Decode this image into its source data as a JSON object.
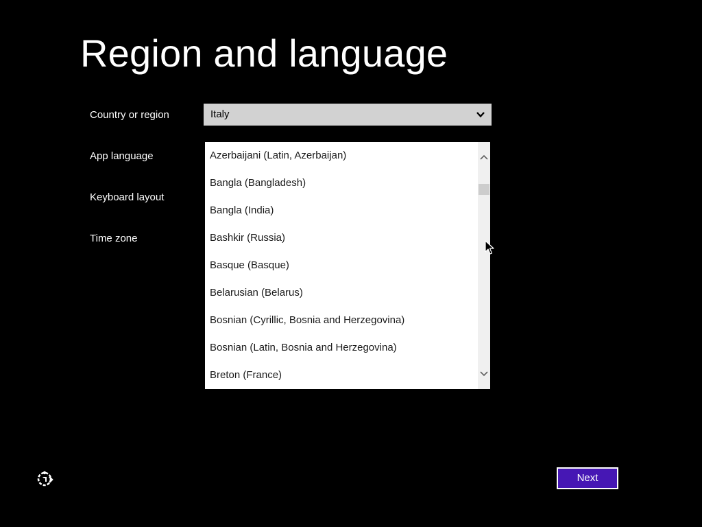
{
  "title": "Region and language",
  "labels": {
    "country": "Country or region",
    "app_language": "App language",
    "keyboard": "Keyboard layout",
    "time_zone": "Time zone"
  },
  "country_select": {
    "value": "Italy",
    "icon": "chevron-down-icon"
  },
  "app_language_list": {
    "items": [
      "Azerbaijani (Latin, Azerbaijan)",
      "Bangla (Bangladesh)",
      "Bangla (India)",
      "Bashkir (Russia)",
      "Basque (Basque)",
      "Belarusian (Belarus)",
      "Bosnian (Cyrillic, Bosnia and Herzegovina)",
      "Bosnian (Latin, Bosnia and Herzegovina)",
      "Breton (France)"
    ]
  },
  "footer": {
    "next_label": "Next",
    "ease_of_access_icon": "ease-of-access-icon"
  },
  "colors": {
    "background": "#000000",
    "accent": "#4617b4",
    "dropdown": "#d2d2d2"
  }
}
